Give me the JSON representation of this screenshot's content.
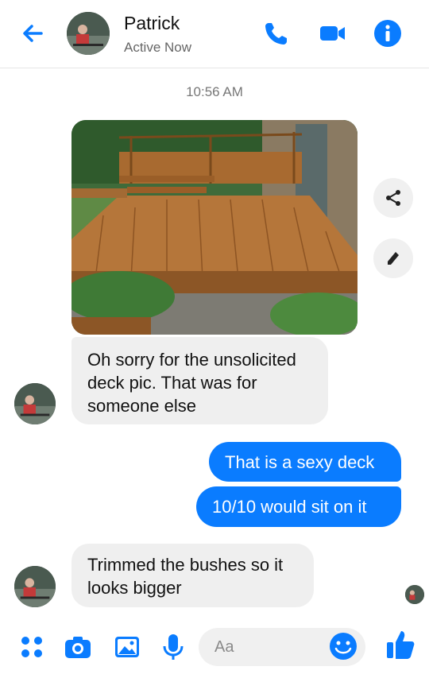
{
  "header": {
    "contact_name": "Patrick",
    "status": "Active Now",
    "back_icon": "back-arrow-icon",
    "actions": [
      "phone-icon",
      "video-camera-icon",
      "info-icon"
    ]
  },
  "timestamp": "10:56 AM",
  "photo": {
    "description_icon": "deck-photo"
  },
  "side_actions": [
    "share-icon",
    "edit-pencil-icon"
  ],
  "messages": [
    {
      "from": "Patrick",
      "text": "Oh sorry for the unsolicited deck pic. That was for someone else"
    },
    {
      "from": "me",
      "text": "That is a sexy deck"
    },
    {
      "from": "me",
      "text": "10/10 would sit on it"
    },
    {
      "from": "Patrick",
      "text": "Trimmed the bushes so it looks bigger"
    }
  ],
  "composer": {
    "placeholder": "Aa",
    "icons": [
      "menu-dots-icon",
      "camera-icon",
      "gallery-icon",
      "microphone-icon",
      "emoji-icon",
      "thumbs-up-icon"
    ]
  },
  "colors": {
    "accent": "#0a7cff",
    "incoming_bubble": "#efefef"
  }
}
